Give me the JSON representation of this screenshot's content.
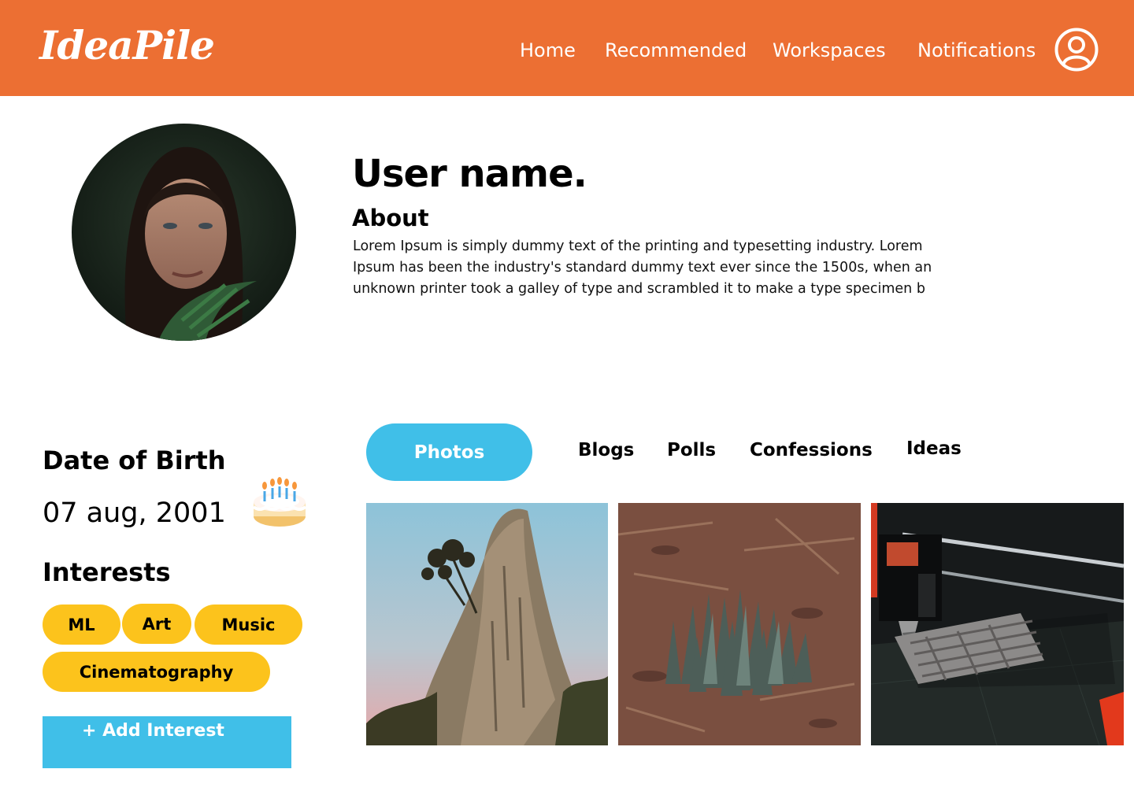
{
  "header": {
    "logo": "IdeaPile",
    "nav": [
      "Home",
      "Recommended",
      "Workspaces",
      "Notifications"
    ],
    "profile_icon": "user-circle-icon"
  },
  "profile": {
    "username": "User name.",
    "about_title": "About",
    "about_text": "Lorem Ipsum is simply dummy text of the printing and typesetting industry. Lorem Ipsum has been the industry's standard dummy text ever since the 1500s, when an unknown printer took a galley of type and scrambled it to make a type specimen b"
  },
  "details": {
    "dob_title": "Date of Birth",
    "dob_value": "07 aug, 2001",
    "dob_icon": "birthday-cake-icon",
    "interests_title": "Interests",
    "interests": [
      "ML",
      "Art",
      "Music",
      "Cinematography"
    ],
    "add_interest": "+ Add Interest"
  },
  "tabs": [
    "Photos",
    "Blogs",
    "Polls",
    "Confessions",
    "Ideas"
  ],
  "active_tab": "Photos",
  "colors": {
    "header": "#EC6F33",
    "accent_blue": "#40BFE8",
    "chip_yellow": "#FCC31C"
  }
}
